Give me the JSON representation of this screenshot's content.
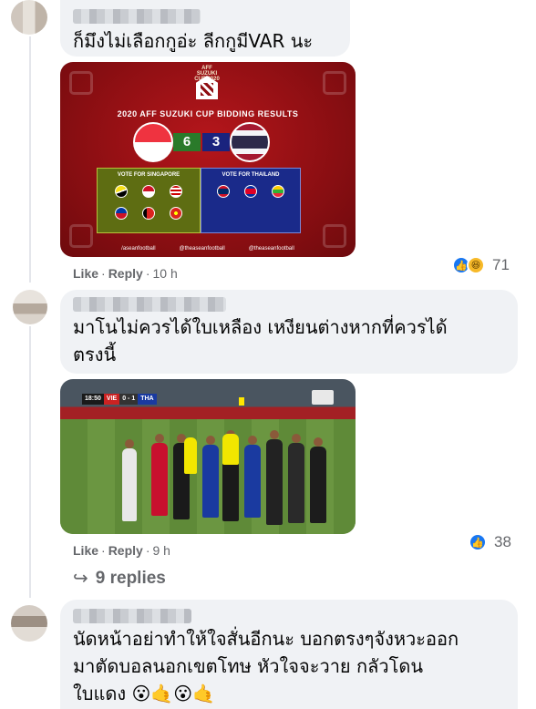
{
  "comments": [
    {
      "text": "ก็มึงไม่เลือกกูอ่ะ ลีกกูมีVAR นะ",
      "actions": {
        "like": "Like",
        "reply": "Reply",
        "time": "10 h"
      },
      "reaction_count": "71",
      "reaction_icons": [
        "like-icon",
        "haha-icon"
      ]
    },
    {
      "text_line1": "มาโนไม่ควรได้ใบเหลือง เหงียนต่างหากที่ควรได้",
      "text_line2": "ตรงนี้",
      "actions": {
        "like": "Like",
        "reply": "Reply",
        "time": "9 h"
      },
      "reaction_count": "38",
      "reaction_icons": [
        "like-icon"
      ],
      "replies_label": "9 replies"
    },
    {
      "text_line1": "นัดหน้าอย่าทำให้ใจสั่นอีกนะ บอกตรงๆจังหวะออก",
      "text_line2": "มาตัดบอลนอกเขตโทษ หัวใจจะวาย กลัวโดน",
      "text_line3": "ใบแดง",
      "emojis": "😮🤙😮🤙"
    }
  ],
  "image1": {
    "logo_text": "AFF SUZUKI CUP 2020",
    "title": "2020 AFF SUZUKI CUP BIDDING RESULTS",
    "score_left": "6",
    "score_right": "3",
    "vote_left_label": "VOTE FOR SINGAPORE",
    "vote_right_label": "VOTE FOR THAILAND",
    "social_1": "/aseanfootball",
    "social_2": "@theaseanfootball",
    "social_3": "@theaseanfootball"
  },
  "image2": {
    "scorebug_time": "18:50",
    "scorebug_team1": "VIE",
    "scorebug_score": "0 - 1",
    "scorebug_team2": "THA"
  }
}
